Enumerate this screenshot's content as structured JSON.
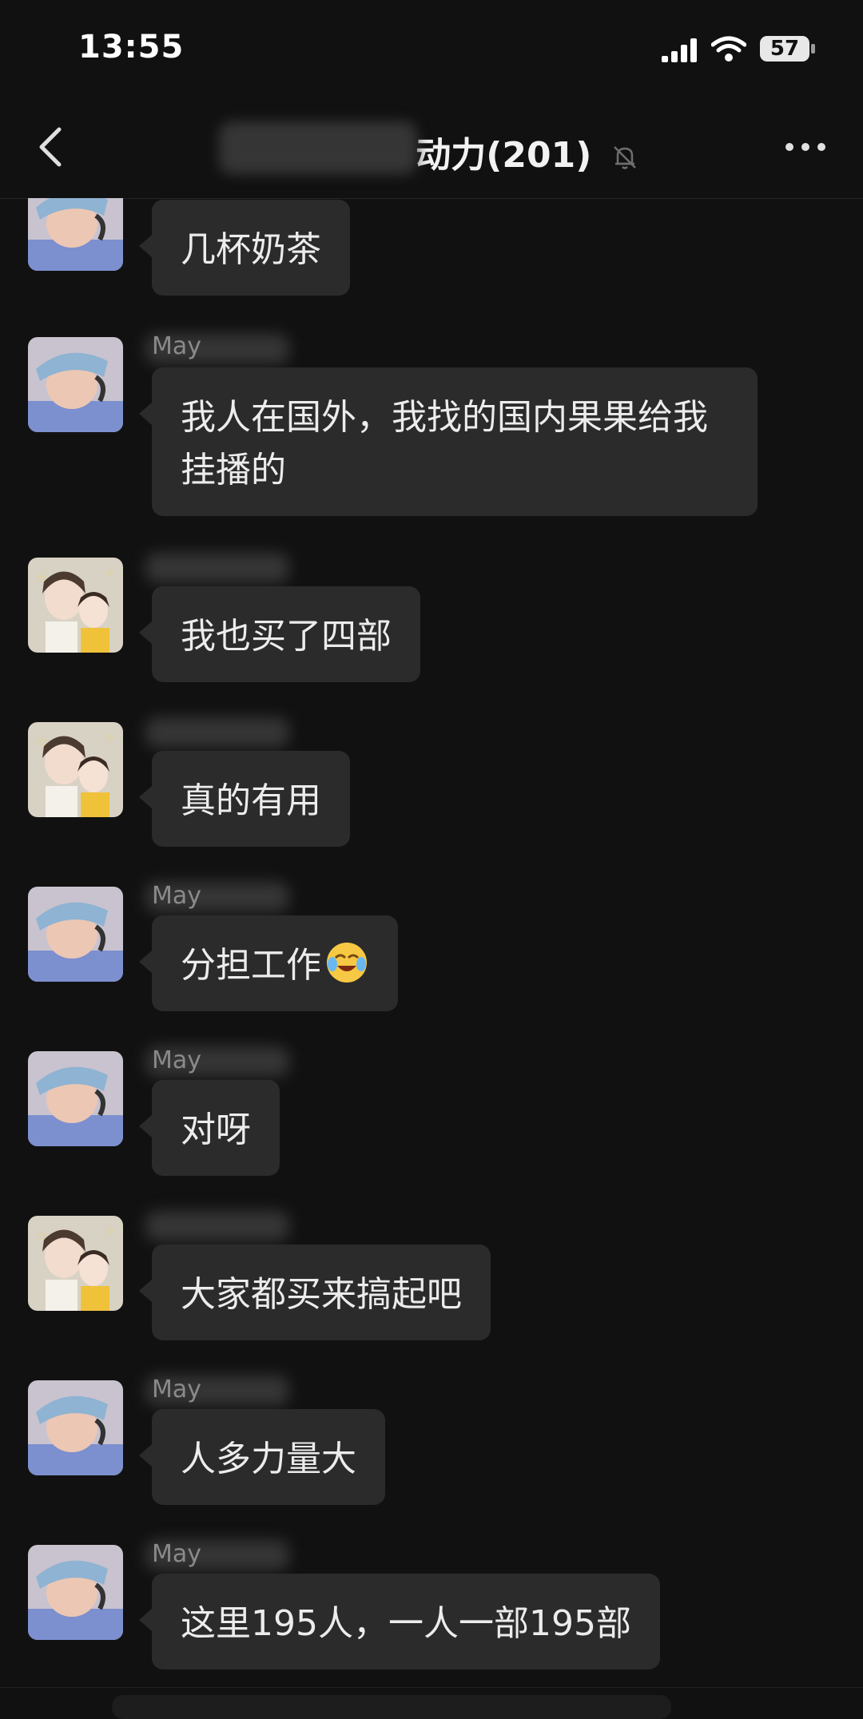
{
  "status_bar": {
    "time": "13:55",
    "battery": "57"
  },
  "nav": {
    "title_suffix": "动力(201)"
  },
  "messages": [
    {
      "sender": "",
      "avatar": "boy",
      "text": "几杯奶茶"
    },
    {
      "sender": "May",
      "avatar": "boy",
      "text": "我人在国外，我找的国内果果给我挂播的"
    },
    {
      "sender": "",
      "avatar": "girls",
      "text": "我也买了四部"
    },
    {
      "sender": "",
      "avatar": "girls",
      "text": "真的有用"
    },
    {
      "sender": "May",
      "avatar": "boy",
      "text": "分担工作"
    },
    {
      "sender": "May",
      "avatar": "boy",
      "text": "对呀"
    },
    {
      "sender": "",
      "avatar": "girls",
      "text": "大家都买来搞起吧"
    },
    {
      "sender": "May",
      "avatar": "boy",
      "text": "人多力量大"
    },
    {
      "sender": "May",
      "avatar": "boy",
      "text": "这里195人，一人一部195部"
    }
  ],
  "icons": {
    "back": "chevron-left-icon",
    "mute": "bell-slash-icon",
    "more": "ellipsis-icon",
    "emoji": "crying-laughing-emoji"
  },
  "colors": {
    "background": "#111111",
    "bubble": "#2b2b2b",
    "text": "#ececec"
  }
}
